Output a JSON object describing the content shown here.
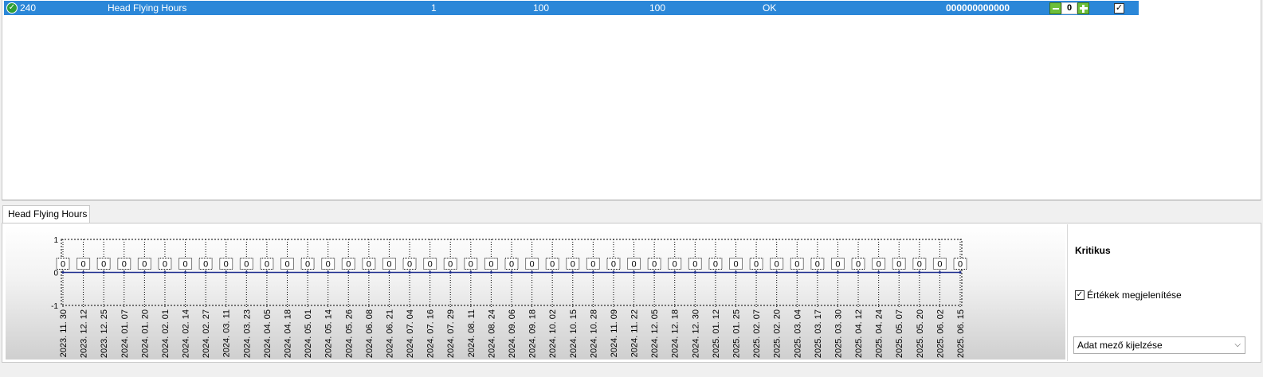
{
  "grid": {
    "row": {
      "status_icon": "check-circle-icon",
      "id": "240",
      "name": "Head Flying Hours",
      "col3": "1",
      "col4": "100",
      "col5": "100",
      "status": "OK",
      "code": "000000000000",
      "counter_value": "0",
      "checked": true
    }
  },
  "tab": {
    "label": "Head Flying Hours"
  },
  "side_panel": {
    "kritikus_label": "Kritikus",
    "show_values_label": "Értékek megjelenítése",
    "show_values_checked": true,
    "field_select_value": "Adat mező kijelzése"
  },
  "chart_data": {
    "type": "line",
    "title": "",
    "xlabel": "",
    "ylabel": "",
    "ylim": [
      -1,
      1
    ],
    "yticks": [
      "1",
      "0",
      "-1"
    ],
    "categories": [
      "2023. 11. 30",
      "2023. 12. 12",
      "2023. 12. 25",
      "2024. 01. 07",
      "2024. 01. 20",
      "2024. 02. 01",
      "2024. 02. 14",
      "2024. 02. 27",
      "2024. 03. 11",
      "2024. 03. 23",
      "2024. 04. 05",
      "2024. 04. 18",
      "2024. 05. 01",
      "2024. 05. 14",
      "2024. 05. 26",
      "2024. 06. 08",
      "2024. 06. 21",
      "2024. 07. 04",
      "2024. 07. 16",
      "2024. 07. 29",
      "2024. 08. 11",
      "2024. 08. 24",
      "2024. 09. 06",
      "2024. 09. 18",
      "2024. 10. 02",
      "2024. 10. 15",
      "2024. 10. 28",
      "2024. 11. 09",
      "2024. 11. 22",
      "2024. 12. 05",
      "2024. 12. 18",
      "2024. 12. 30",
      "2025. 01. 12",
      "2025. 01. 25",
      "2025. 02. 07",
      "2025. 02. 20",
      "2025. 03. 04",
      "2025. 03. 17",
      "2025. 03. 30",
      "2025. 04. 12",
      "2025. 04. 24",
      "2025. 05. 07",
      "2025. 05. 20",
      "2025. 06. 02",
      "2025. 06. 15"
    ],
    "values": [
      0,
      0,
      0,
      0,
      0,
      0,
      0,
      0,
      0,
      0,
      0,
      0,
      0,
      0,
      0,
      0,
      0,
      0,
      0,
      0,
      0,
      0,
      0,
      0,
      0,
      0,
      0,
      0,
      0,
      0,
      0,
      0,
      0,
      0,
      0,
      0,
      0,
      0,
      0,
      0,
      0,
      0,
      0,
      0,
      0
    ],
    "grid": true,
    "line_color": "#1f2f8f",
    "point_labels": true
  }
}
